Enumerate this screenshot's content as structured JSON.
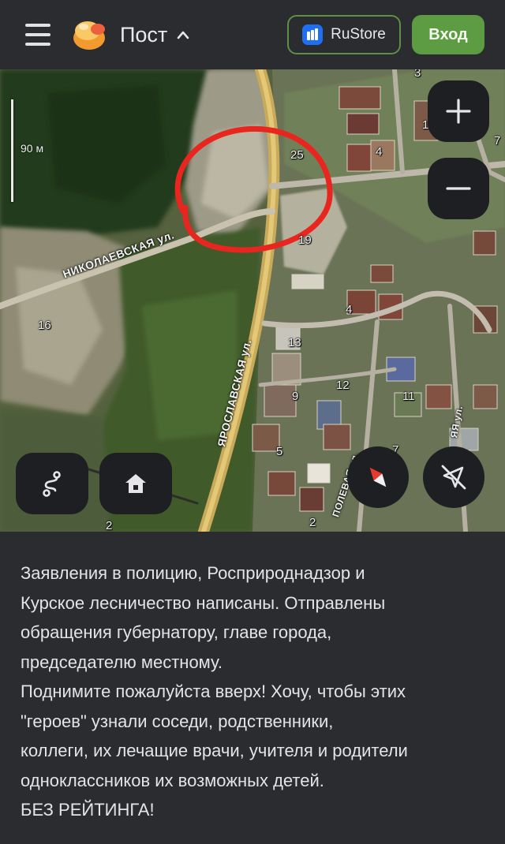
{
  "header": {
    "menu_icon": "hamburger-menu-icon",
    "logo_icon": "pikabu-logo-icon",
    "title": "Пост",
    "title_caret_icon": "chevron-up-icon",
    "rustore_label": "RuStore",
    "rustore_icon": "rustore-icon",
    "login_label": "Вход",
    "colors": {
      "accent_green": "#5d9c43",
      "background": "#2b2c30",
      "rustore_blue": "#1f6ff2"
    }
  },
  "map": {
    "scale_label": "90 м",
    "streets": [
      "НИКОЛАЕВСКАЯ ул.",
      "ЯРОСЛАВСКАЯ ул.",
      "ПОЛЕВАЯ ул.",
      "ЯЯ ул."
    ],
    "house_numbers": [
      "3",
      "1",
      "4",
      "7",
      "25",
      "19",
      "16",
      "4",
      "13",
      "12",
      "9",
      "11",
      "5",
      "7",
      "2",
      "2"
    ],
    "controls": {
      "zoom_in_icon": "plus-icon",
      "zoom_out_icon": "minus-icon",
      "route_icon": "route-icon",
      "home_icon": "home-icon",
      "compass_icon": "compass-icon",
      "navigation_off_icon": "navigation-off-icon"
    },
    "annotation_color": "#e8261f"
  },
  "post": {
    "lines": [
      "Заявления в полицию, Росприроднадзор и",
      "Курское лесничество написаны. Отправлены",
      "обращения губернатору, главе города,",
      "председателю местному.",
      "Поднимите пожалуйста вверх! Хочу, чтобы этих",
      "\"героев\" узнали соседи, родственники,",
      "коллеги, их лечащие врачи, учителя и родители",
      "одноклассников их возможных детей.",
      "БЕЗ РЕЙТИНГА!"
    ]
  }
}
